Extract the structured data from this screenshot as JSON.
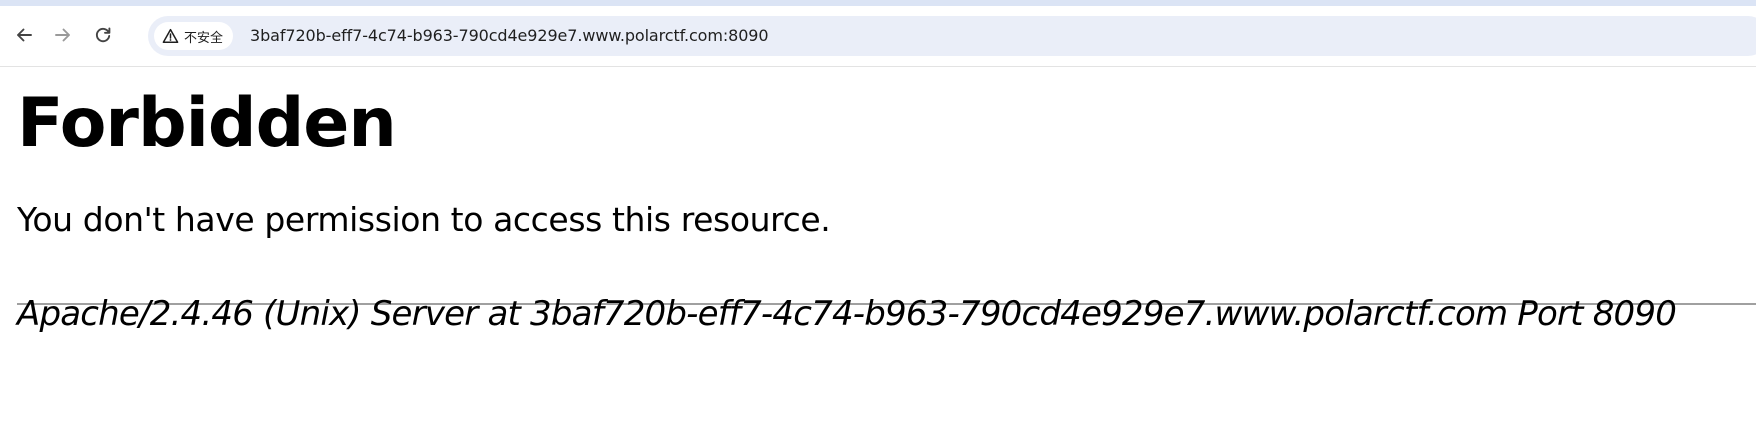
{
  "browser": {
    "nav": {
      "back_icon": "arrow-left-icon",
      "forward_icon": "arrow-right-icon",
      "reload_icon": "reload-icon"
    },
    "omnibox": {
      "security_icon": "warning-triangle-icon",
      "security_label": "不安全",
      "url": "3baf720b-eff7-4c74-b963-790cd4e929e7.www.polarctf.com:8090"
    },
    "colors": {
      "top_strip": "#dbe4f5",
      "omnibox_bg": "#eaeef8",
      "rule": "#a0a0a0"
    }
  },
  "page": {
    "heading": "Forbidden",
    "message": "You don't have permission to access this resource.",
    "server_signature": "Apache/2.4.46 (Unix) Server at 3baf720b-eff7-4c74-b963-790cd4e929e7.www.polarctf.com Port 8090"
  }
}
